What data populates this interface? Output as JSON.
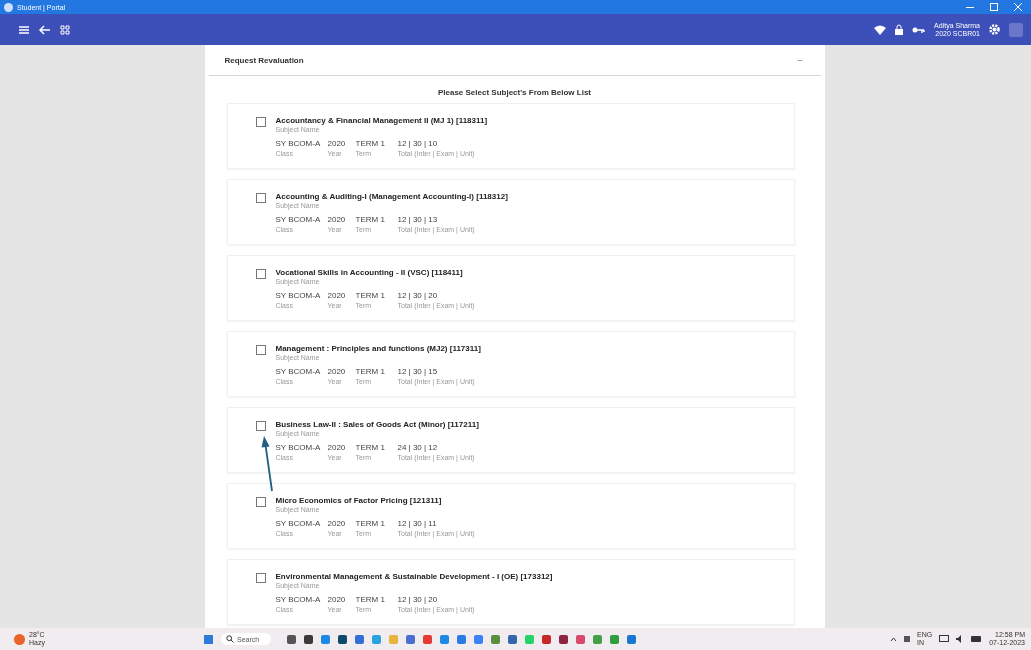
{
  "window": {
    "title": "Student | Portal"
  },
  "user": {
    "name": "Aditya Sharma",
    "id": "2020 SCBR01"
  },
  "panel": {
    "title": "Request Revaluation",
    "collapse": "–",
    "heading": "Please Select Subject's From Below List"
  },
  "subjects": [
    {
      "name": "Accountancy & Financial Management II (MJ 1) [118311]",
      "name_label": "Subject Name",
      "class": "SY BCOM-A",
      "class_label": "Class",
      "year": "2020",
      "year_label": "Year",
      "term": "TERM 1",
      "term_label": "Term",
      "total": "12 | 30 | 10",
      "total_label": "Total (Inter | Exam | Unit)",
      "checked": false
    },
    {
      "name": "Accounting & Auditing-I (Management Accounting-I) [118312]",
      "name_label": "Subject Name",
      "class": "SY BCOM-A",
      "class_label": "Class",
      "year": "2020",
      "year_label": "Year",
      "term": "TERM 1",
      "term_label": "Term",
      "total": "12 | 30 | 13",
      "total_label": "Total (Inter | Exam | Unit)",
      "checked": false
    },
    {
      "name": "Vocational Skills in Accounting - II (VSC) [118411]",
      "name_label": "Subject Name",
      "class": "SY BCOM-A",
      "class_label": "Class",
      "year": "2020",
      "year_label": "Year",
      "term": "TERM 1",
      "term_label": "Term",
      "total": "12 | 30 | 20",
      "total_label": "Total (Inter | Exam | Unit)",
      "checked": false
    },
    {
      "name": "Management : Principles and functions (MJ2) [117311]",
      "name_label": "Subject Name",
      "class": "SY BCOM-A",
      "class_label": "Class",
      "year": "2020",
      "year_label": "Year",
      "term": "TERM 1",
      "term_label": "Term",
      "total": "12 | 30 | 15",
      "total_label": "Total (Inter | Exam | Unit)",
      "checked": false
    },
    {
      "name": "Business Law-II : Sales of Goods Act (Minor) [117211]",
      "name_label": "Subject Name",
      "class": "SY BCOM-A",
      "class_label": "Class",
      "year": "2020",
      "year_label": "Year",
      "term": "TERM 1",
      "term_label": "Term",
      "total": "24 | 30 | 12",
      "total_label": "Total (Inter | Exam | Unit)",
      "checked": false
    },
    {
      "name": "Micro Economics of Factor Pricing [121311]",
      "name_label": "Subject Name",
      "class": "SY BCOM-A",
      "class_label": "Class",
      "year": "2020",
      "year_label": "Year",
      "term": "TERM 1",
      "term_label": "Term",
      "total": "12 | 30 | 11",
      "total_label": "Total (Inter | Exam | Unit)",
      "checked": false
    },
    {
      "name": "Environmental Management & Sustainable Development - I (OE) [173312]",
      "name_label": "Subject Name",
      "class": "SY BCOM-A",
      "class_label": "Class",
      "year": "2020",
      "year_label": "Year",
      "term": "TERM 1",
      "term_label": "Term",
      "total": "12 | 30 | 20",
      "total_label": "Total (Inter | Exam | Unit)",
      "checked": false
    }
  ],
  "taskbar": {
    "weather": "28°C",
    "weather_note": "Hazy",
    "search": "Search",
    "lang": "ENG",
    "region": "IN",
    "time": "12:58 PM",
    "date": "07-12-2023"
  }
}
